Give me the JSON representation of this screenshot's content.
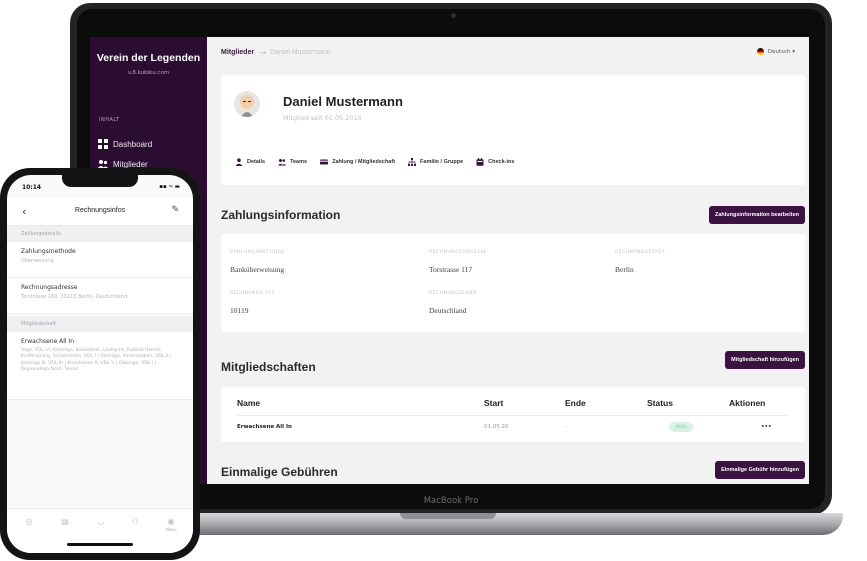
{
  "laptop": {
    "brand": "MacBook Pro",
    "sidebar": {
      "org_name": "Verein der Legenden",
      "org_domain": "v.8.kubiku.com",
      "section": "INHALT",
      "items": [
        {
          "label": "Dashboard",
          "icon": "grid-icon"
        },
        {
          "label": "Mitglieder",
          "icon": "users-icon"
        }
      ]
    },
    "topbar": {
      "breadcrumb_root": "Mitglieder",
      "breadcrumb_sep": "→",
      "breadcrumb_current": "Daniel Mustermann",
      "language": "Deutsch ▾"
    },
    "profile": {
      "name": "Daniel Mustermann",
      "member_since": "Mitglied seit 01.05.2015",
      "tabs": [
        {
          "label": "Details",
          "icon": "person-icon"
        },
        {
          "label": "Teams",
          "icon": "team-icon"
        },
        {
          "label": "Zahlung / Mitgliedschaft",
          "icon": "payment-icon"
        },
        {
          "label": "Familie / Gruppe",
          "icon": "family-icon"
        },
        {
          "label": "Check-ins",
          "icon": "calendar-icon"
        }
      ]
    },
    "payment": {
      "title": "Zahlungsinformation",
      "edit_button": "Zahlungsinformation bearbeiten",
      "fields": [
        {
          "label": "ZAHLUNGSMETHODE",
          "value": "Banküberweisung"
        },
        {
          "label": "RECHNUNGSADRESSE",
          "value": "Torstrasse 117"
        },
        {
          "label": "RECHNUNGSSTADT",
          "value": "Berlin"
        },
        {
          "label": "RECHNUNGS PLZ",
          "value": "10119"
        },
        {
          "label": "RECHNUNGSLAND",
          "value": "Deutschland"
        }
      ]
    },
    "memberships": {
      "title": "Mitgliedschaften",
      "add_button": "Mitgliedschaft hinzufügen",
      "columns": [
        "Name",
        "Start",
        "Ende",
        "Status",
        "Aktionen"
      ],
      "rows": [
        {
          "name": "Erwachsene All In",
          "start": "01.05.20",
          "end": "-",
          "status": "Aktiv",
          "actions": "•••"
        }
      ]
    },
    "fees": {
      "title": "Einmalige Gebühren",
      "add_button": "Einmalige Gebühr hinzufügen"
    }
  },
  "phone": {
    "time": "10:14",
    "status": "▪▪ ≈ ▬",
    "title": "Rechnungsinfos",
    "back": "‹",
    "edit": "✎",
    "section_payment": "Zahlungsdetails",
    "payment_method_label": "Zahlungsmethode",
    "payment_method_value": "Überweisung",
    "billing_address_label": "Rechnungsadresse",
    "billing_address_value": "Torstrasse 160, 10115 Berlin, Deutschland",
    "section_membership": "Mitgliedschaft",
    "membership_name": "Erwachsene All In",
    "membership_details": "Yoga, VDL U | Kreisliga, Basketball, Laufsport, Fußball Herren, Krafttraining, Schwimmen, VDL I | Oberliga, Vereinsleben, VDL II | Kreisliga B, VDL III | Kreisklasse A, VDL V | Oberliga, VDL I | Regionalliga Nord, Tennis",
    "tab_last_label": "Menu"
  }
}
